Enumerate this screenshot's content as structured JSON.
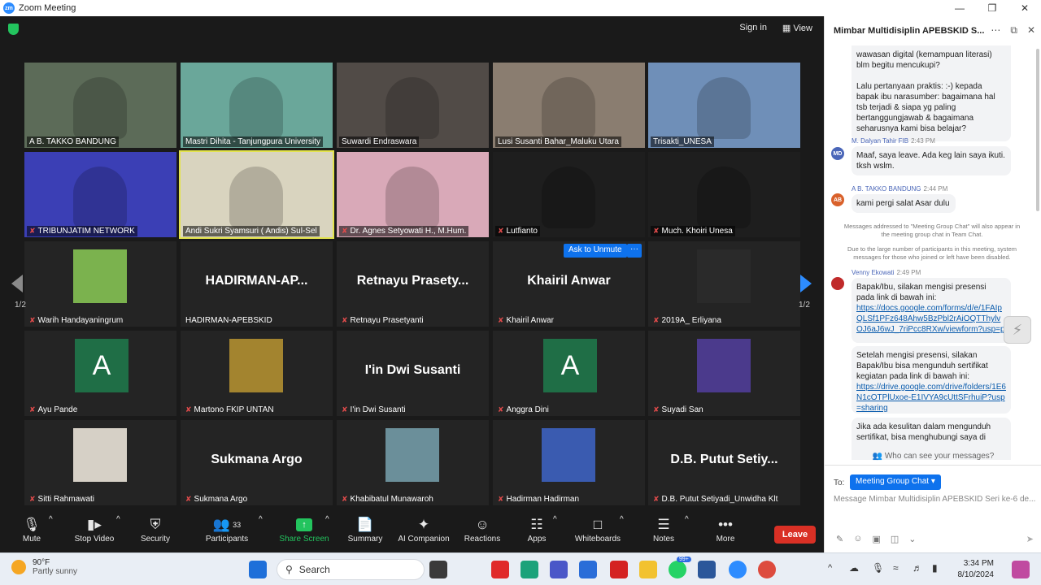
{
  "window": {
    "title": "Zoom Meeting",
    "icon": "zm"
  },
  "topbar": {
    "sign_in": "Sign in",
    "view": "View"
  },
  "pager": {
    "left": "1/2",
    "right": "1/2"
  },
  "tiles": [
    {
      "name": "A B. TAKKO BANDUNG",
      "type": "video",
      "muted": false,
      "color": "#5c6b58"
    },
    {
      "name": "Mastri Dihita - Tanjungpura University",
      "type": "video",
      "muted": false,
      "color": "#6aa79a"
    },
    {
      "name": "Suwardi Endraswara",
      "type": "video",
      "muted": false,
      "color": "#514b47"
    },
    {
      "name": "Lusi Susanti Bahar_Maluku Utara",
      "type": "video",
      "muted": false,
      "color": "#8a7d70"
    },
    {
      "name": "Trisakti_UNESA",
      "type": "video",
      "muted": false,
      "color": "#6f8fb8"
    },
    {
      "name": "TRIBUNJATIM NETWORK",
      "type": "video",
      "muted": true,
      "color": "#3b3fb5"
    },
    {
      "name": "Andi Sukri Syamsuri ( Andis) Sul-Sel",
      "type": "video",
      "muted": false,
      "color": "#d9d4bf",
      "speaker": true
    },
    {
      "name": "Dr. Agnes Setyowati H., M.Hum.",
      "type": "video",
      "muted": true,
      "color": "#d9a9b8"
    },
    {
      "name": "Lutfianto",
      "type": "video",
      "muted": true,
      "color": "#1e1e1e"
    },
    {
      "name": "Much. Khoiri Unesa",
      "type": "video",
      "muted": true,
      "color": "#1e1e1e"
    },
    {
      "name": "Warih Handayaningrum",
      "type": "photo",
      "muted": true,
      "color": "#7bb24e"
    },
    {
      "name": "HADIRMAN-APEBSKID",
      "type": "text",
      "muted": false,
      "label": "HADIRMAN-AP..."
    },
    {
      "name": "Retnayu Prasetyanti",
      "type": "text",
      "muted": true,
      "label": "Retnayu  Prasety..."
    },
    {
      "name": "Khairil Anwar",
      "type": "text",
      "muted": true,
      "label": "Khairil Anwar"
    },
    {
      "name": "2019A_ Erliyana",
      "type": "photo",
      "muted": true,
      "color": "#2a2a2a"
    },
    {
      "name": "Ayu Pande",
      "type": "letter",
      "muted": true,
      "label": "A"
    },
    {
      "name": "Martono FKIP UNTAN",
      "type": "photo",
      "muted": true,
      "color": "#a3842f"
    },
    {
      "name": "I'in Dwi Susanti",
      "type": "text",
      "muted": true,
      "label": "I'in Dwi Susanti"
    },
    {
      "name": "Anggra Dini",
      "type": "letter",
      "muted": true,
      "label": "A"
    },
    {
      "name": "Suyadi San",
      "type": "photo",
      "muted": true,
      "color": "#4b3a8c"
    },
    {
      "name": "Sitti Rahmawati",
      "type": "photo",
      "muted": true,
      "color": "#d6d0c6"
    },
    {
      "name": "Sukmana Argo",
      "type": "text",
      "muted": true,
      "label": "Sukmana Argo"
    },
    {
      "name": "Khabibatul Munawaroh",
      "type": "photo",
      "muted": true,
      "color": "#6b8f9a"
    },
    {
      "name": "Hadirman Hadirman",
      "type": "photo",
      "muted": true,
      "color": "#3a5bb0"
    },
    {
      "name": "D.B. Putut Setiyadi_Unwidha Klt",
      "type": "text",
      "muted": true,
      "label": "D.B.  Putut  Setiy..."
    }
  ],
  "hover": {
    "ask_unmute": "Ask to Unmute",
    "more": "···"
  },
  "toolbar": {
    "mute": "Mute",
    "stop_video": "Stop Video",
    "security": "Security",
    "participants": "Participants",
    "participants_count": "33",
    "share_screen": "Share Screen",
    "summary": "Summary",
    "ai_companion": "AI Companion",
    "reactions": "Reactions",
    "apps": "Apps",
    "whiteboards": "Whiteboards",
    "notes": "Notes",
    "more": "More",
    "leave": "Leave"
  },
  "chat": {
    "title": "Mimbar Multidisiplin APEBSKID S...",
    "msg0": "wawasan digital (kemampuan literasi) blm begitu mencukupi?",
    "msg0b": "Lalu pertanyaan praktis: :-) kepada bapak ibu narasumber: bagaimana hal tsb terjadi & siapa yg paling bertanggungjawab & bagaimana seharusnya kami bisa belajar?",
    "m1_initials": "MD",
    "m1_sender": "M. Dalyan Tahir FIB",
    "m1_time": "2:43 PM",
    "m1_text": "Maaf, saya leave. Ada keg lain saya ikuti. tksh wslm.",
    "m2_initials": "AB",
    "m2_sender": "A B. TAKKO BANDUNG",
    "m2_time": "2:44 PM",
    "m2_text": "kami pergi salat Asar dulu",
    "sys1": "Messages addressed to \"Meeting Group Chat\" will also appear in the meeting group chat in Team Chat.",
    "sys2": "Due to the large number of participants in this meeting, system messages for those who joined or left have been disabled.",
    "m3_sender": "Venny Ekowati",
    "m3_time": "2:49 PM",
    "m3_text1": "Bapak/Ibu, silakan mengisi presensi pada link di bawah ini:",
    "m3_link1": "https://docs.google.com/forms/d/e/1FAIpQLSf1PFz648Ahw5BzPbl2rAiOQTThylvOJ6aJ6wJ_7riPcc8RXw/viewform?usp=pp_url",
    "m3_text2": "Setelah mengisi presensi, silakan Bapak/Ibu bisa mengunduh sertifikat kegiatan pada link di bawah ini:",
    "m3_link2": "https://drive.google.com/drive/folders/1E6N1cOTPlUxoe-E1IVYA9cUttSFrhuiP?usp=sharing",
    "m3_text3": "Jika ada kesulitan dalam mengunduh sertifikat, bisa menghubungi saya di",
    "who_can_see": "Who can see your messages?",
    "to_label": "To:",
    "to_value": "Meeting Group Chat",
    "input_placeholder": "Message Mimbar Multidisiplin APEBSKID Seri ke-6 de..."
  },
  "taskbar": {
    "temp": "90°F",
    "weather": "Partly sunny",
    "search": "Search",
    "badge": "99+",
    "time": "3:34 PM",
    "date": "8/10/2024"
  }
}
